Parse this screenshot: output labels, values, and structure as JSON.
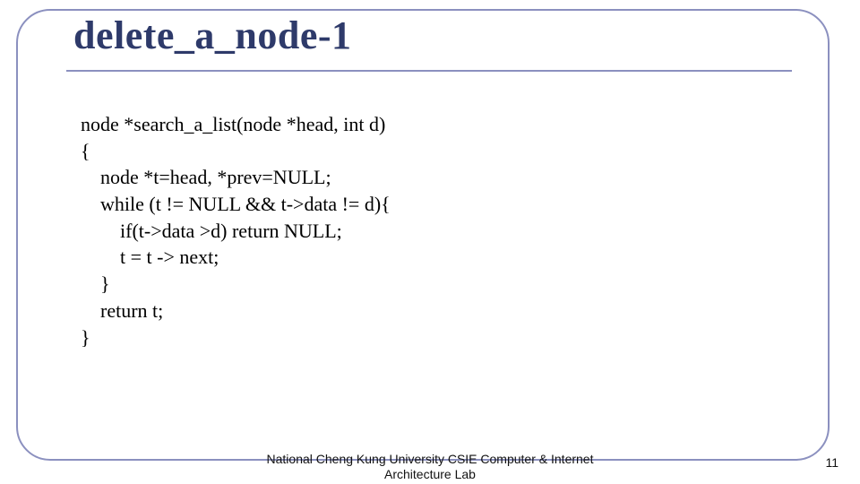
{
  "title": "delete_a_node-1",
  "code": {
    "l1": "node *search_a_list(node *head, int d)",
    "l2": "{",
    "l3": "    node *t=head, *prev=NULL;",
    "l4": "    while (t != NULL && t->data != d){",
    "l5": "        if(t->data >d) return NULL;",
    "l6": "        t = t -> next;",
    "l7": "    }",
    "l8": "    return t;",
    "l9": "}"
  },
  "footer_line1": "National Cheng Kung University CSIE Computer & Internet",
  "footer_line2": "Architecture Lab",
  "page_number": "11"
}
